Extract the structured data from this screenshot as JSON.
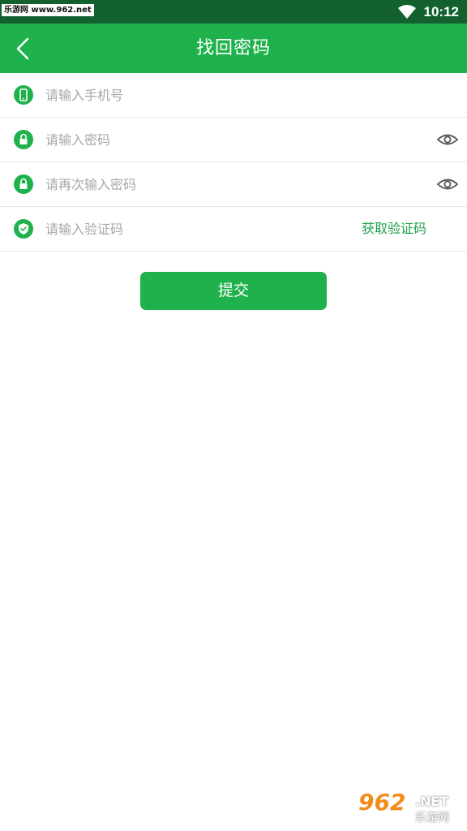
{
  "status_bar": {
    "watermark": "乐游网 www.962.net",
    "time": "10:12"
  },
  "app_bar": {
    "title": "找回密码"
  },
  "form": {
    "phone": {
      "placeholder": "请输入手机号",
      "value": "",
      "icon": "phone-icon"
    },
    "password": {
      "placeholder": "请输入密码",
      "value": "",
      "icon": "lock-icon"
    },
    "confirm_password": {
      "placeholder": "请再次输入密码",
      "value": "",
      "icon": "lock-icon"
    },
    "code": {
      "placeholder": "请输入验证码",
      "value": "",
      "icon": "shield-check-icon",
      "button_label": "获取验证码"
    }
  },
  "submit": {
    "label": "提交"
  },
  "watermark_bottom": {
    "number": "962",
    "domain": ".NET",
    "brand": "乐游网"
  },
  "colors": {
    "primary": "#1fb24c",
    "status_bar": "#13612f",
    "link": "#1fa14a"
  }
}
